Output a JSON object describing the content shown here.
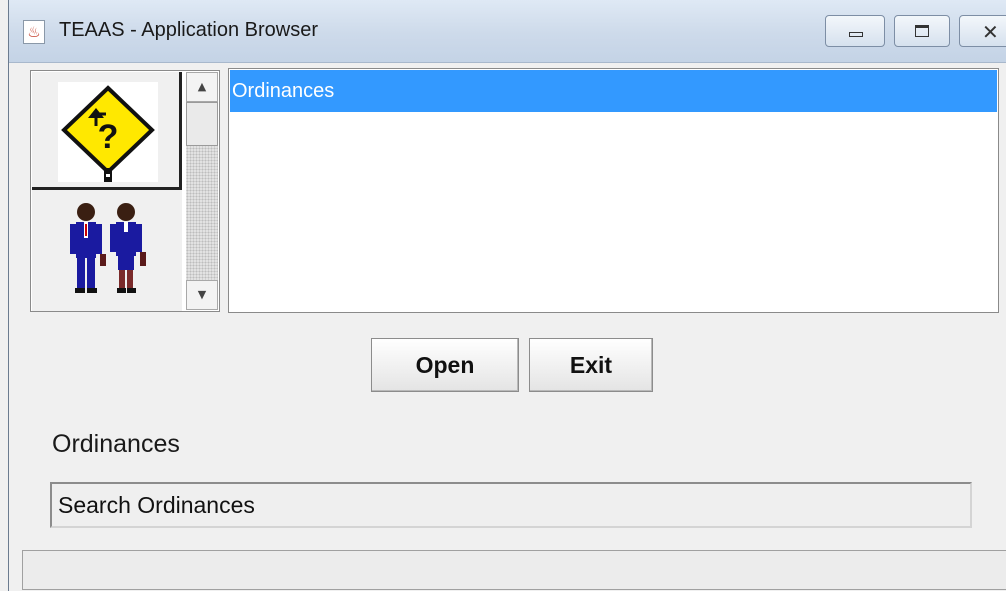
{
  "window": {
    "title": "TEAAS - Application Browser",
    "icon": "java-cup-icon"
  },
  "title_controls": [
    "minimize-icon",
    "maximize-icon",
    "close-icon"
  ],
  "icon_panel": {
    "items": [
      {
        "name": "road-sign-question-icon",
        "selected": true
      },
      {
        "name": "people-icon",
        "selected": false
      }
    ]
  },
  "list": {
    "items": [
      {
        "label": "Ordinances",
        "selected": true
      }
    ]
  },
  "buttons": {
    "open": "Open",
    "exit": "Exit"
  },
  "selected_app": {
    "name": "Ordinances",
    "description": "Search Ordinances"
  },
  "status_bar": "",
  "colors": {
    "selection": "#3399ff",
    "sign_yellow": "#ffe800",
    "suit_blue": "#1a1aa0"
  }
}
